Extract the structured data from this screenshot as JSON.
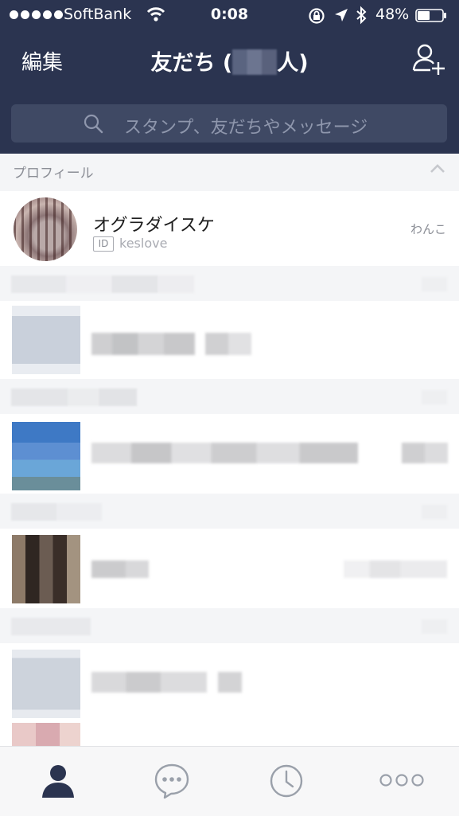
{
  "status_bar": {
    "carrier": "SoftBank",
    "time": "0:08",
    "battery": "48%"
  },
  "nav": {
    "edit_label": "編集",
    "title_prefix": "友だち (",
    "title_suffix": "人)"
  },
  "search": {
    "placeholder": "スタンプ、友だちやメッセージ"
  },
  "profile_section": {
    "title": "プロフィール"
  },
  "profile": {
    "name": "オグラダイスケ",
    "id_badge": "ID",
    "id": "keslove",
    "status": "わんこ"
  },
  "tabs": [
    {
      "icon": "person-icon",
      "active": true
    },
    {
      "icon": "chat-bubble-icon",
      "active": false
    },
    {
      "icon": "clock-icon",
      "active": false
    },
    {
      "icon": "more-icon",
      "active": false
    }
  ],
  "colors": {
    "header_bg": "#2b3450",
    "active_tab": "#2b3450",
    "inactive_tab": "#9aa0aa"
  }
}
